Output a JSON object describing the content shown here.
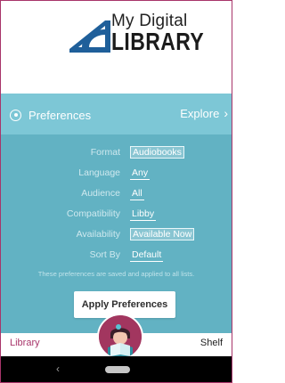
{
  "logo": {
    "line1": "My Digital",
    "line2": "LIBRARY"
  },
  "header": {
    "preferences_label": "Preferences",
    "explore_label": "Explore",
    "explore_chevron": "›"
  },
  "preferences": [
    {
      "label": "Format",
      "value": "Audiobooks",
      "style": "filled"
    },
    {
      "label": "Language",
      "value": "Any",
      "style": "under"
    },
    {
      "label": "Audience",
      "value": "All",
      "style": "under"
    },
    {
      "label": "Compatibility",
      "value": "Libby",
      "style": "under"
    },
    {
      "label": "Availability",
      "value": "Available Now",
      "style": "filled"
    },
    {
      "label": "Sort By",
      "value": "Default",
      "style": "under"
    }
  ],
  "note": "These preferences are saved and applied to all lists.",
  "apply_button": "Apply Preferences",
  "bottom_nav": {
    "library": "Library",
    "shelf": "Shelf"
  },
  "system_nav": {
    "back": "‹"
  },
  "colors": {
    "header": "#7dc7d6",
    "panel": "#62b2c3",
    "accent": "#a8356a",
    "avatar": "#a2365f"
  }
}
